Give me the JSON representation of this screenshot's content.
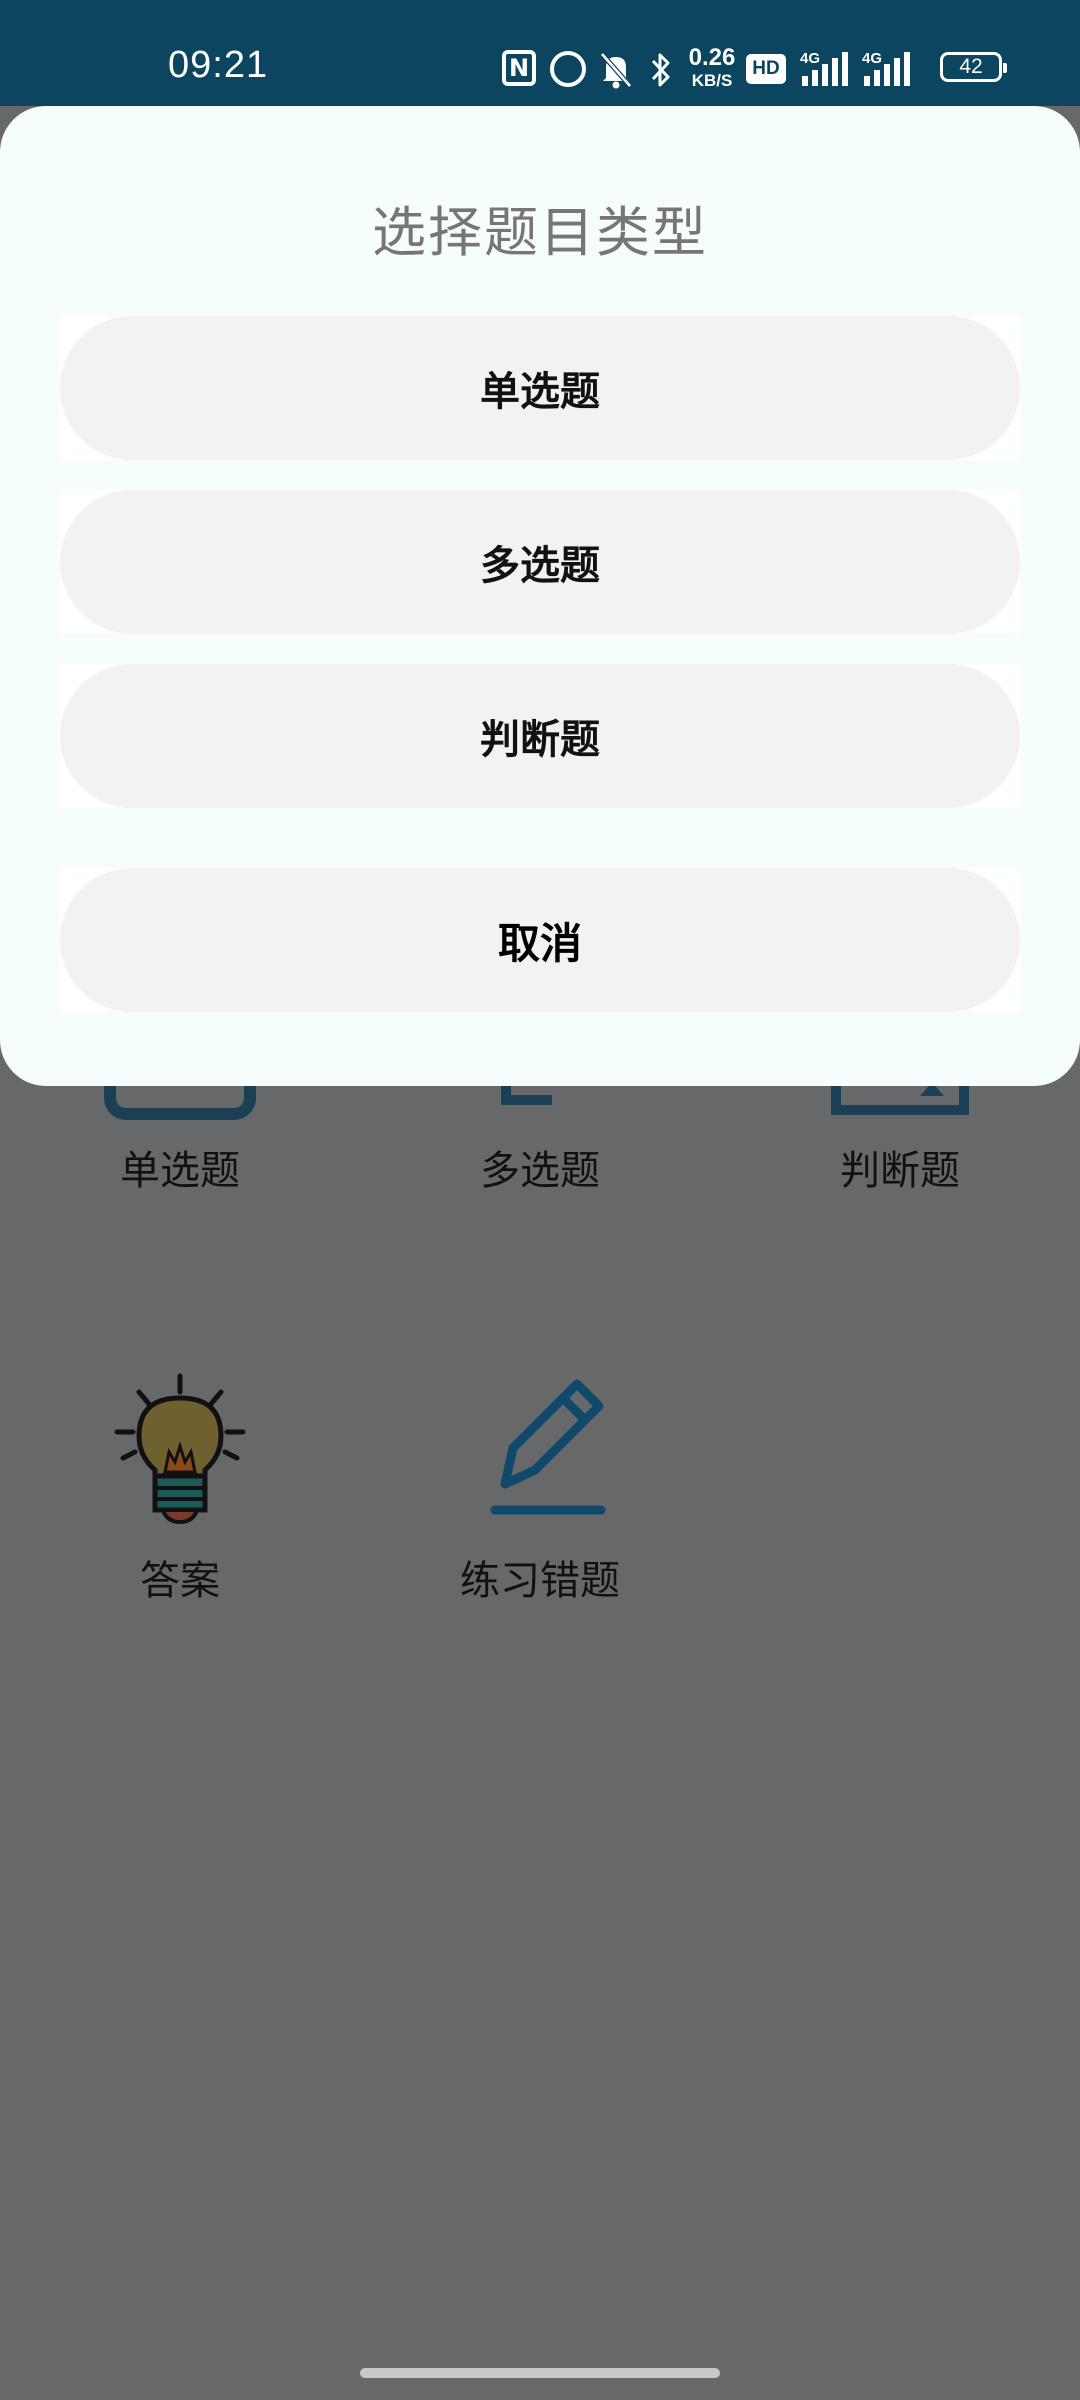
{
  "status_bar": {
    "time": "09:21",
    "nfc_label": "N",
    "net_speed_value": "0.26",
    "net_speed_unit": "KB/S",
    "hd_label": "HD",
    "sim1_label": "4G",
    "sim2_label": "4G",
    "battery": "42",
    "icons": [
      "nfc-icon",
      "alarm-icon",
      "mute-bell-icon",
      "bluetooth-icon",
      "hd-icon",
      "signal-icon",
      "signal-icon",
      "battery-icon"
    ]
  },
  "dialog": {
    "title": "选择题目类型",
    "options": [
      {
        "label": "单选题"
      },
      {
        "label": "多选题"
      },
      {
        "label": "判断题"
      }
    ],
    "cancel_label": "取消"
  },
  "grid": {
    "items": [
      {
        "label": "单选题",
        "icon": "single-choice-icon"
      },
      {
        "label": "多选题",
        "icon": "multi-choice-icon"
      },
      {
        "label": "判断题",
        "icon": "judge-icon"
      },
      {
        "label": "答案",
        "icon": "lightbulb-icon"
      },
      {
        "label": "练习错题",
        "icon": "pencil-icon"
      }
    ]
  },
  "colors": {
    "status_bar": "#0b4560",
    "scrim": "#66686a",
    "dialog_bg": "#f5fdfd",
    "button_bg": "#f2f2f2",
    "icon_stroke": "#0f4a6a"
  }
}
